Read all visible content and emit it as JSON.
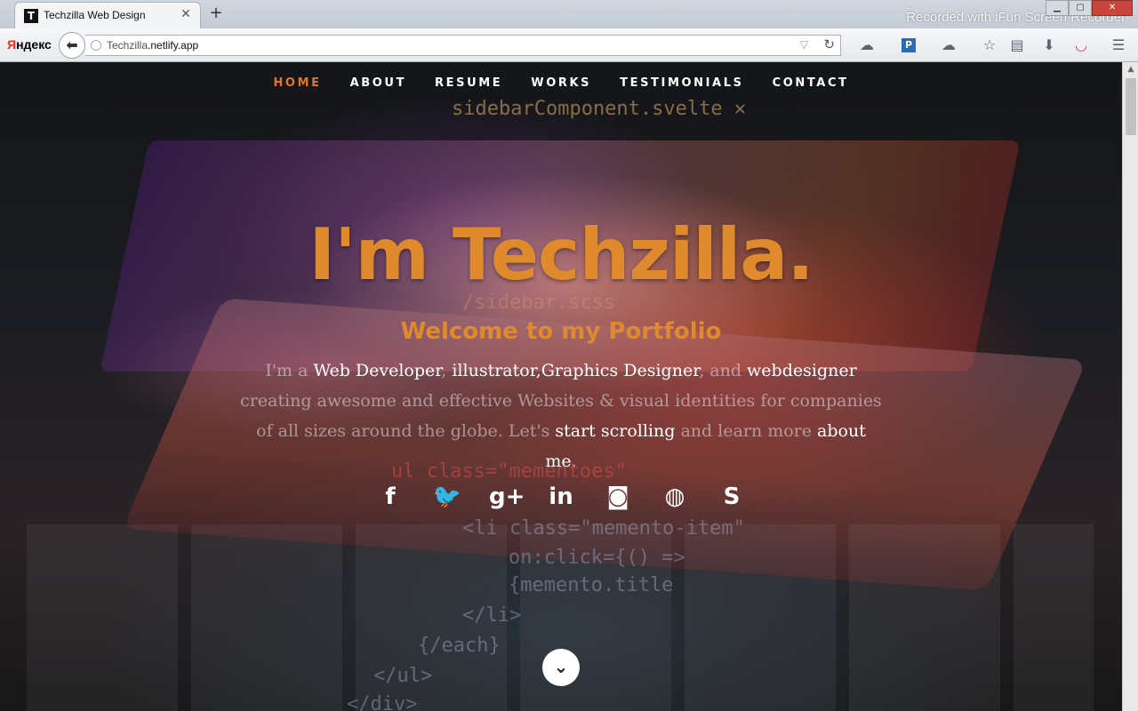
{
  "browser": {
    "tab_title": "Techzilla Web Design",
    "tab_favicon": "T",
    "tab_close": "✕",
    "new_tab": "+",
    "window_min": "▁",
    "window_max": "▢",
    "window_close": "✕",
    "watermark": "Recorded with iFun Screen Recorder",
    "yandex_first": "Я",
    "yandex_rest": "ндекс",
    "back_icon": "⬅",
    "url_host": "Techzilla",
    "url_rest": ".netlify.app",
    "url_dropdown": "▽",
    "reload_icon": "↻",
    "toolbar_icons": [
      "cloud-icon",
      "pocket-badge-icon",
      "cloud-icon",
      "bookmark-star-icon",
      "reading-list-icon",
      "download-icon",
      "pocket-icon",
      "menu-icon"
    ],
    "toolbar_glyphs": [
      "☁",
      "P",
      "☁",
      "☆",
      "▤",
      "⬇",
      "◡",
      "☰"
    ]
  },
  "site": {
    "nav": [
      {
        "label": "HOME",
        "active": true
      },
      {
        "label": "ABOUT",
        "active": false
      },
      {
        "label": "RESUME",
        "active": false
      },
      {
        "label": "WORKS",
        "active": false
      },
      {
        "label": "TESTIMONIALS",
        "active": false
      },
      {
        "label": "CONTACT",
        "active": false
      }
    ],
    "accent_color": "#e08a2e",
    "title": "I'm Techzilla.",
    "subtitle": "Welcome to my Portfolio",
    "desc": {
      "p1": "I'm a ",
      "h1": "Web Developer",
      "p2": ", ",
      "h2": "illustrator,Graphics Designer",
      "p3": ", and ",
      "h3": "webdesigner",
      "p4": " creating awesome and effective Websites & visual identities for companies of all sizes around the globe. Let's ",
      "h4": "start scrolling",
      "p5": " and learn more ",
      "h5": "about me",
      "p6": "."
    },
    "social": [
      {
        "name": "facebook-icon",
        "glyph": "f"
      },
      {
        "name": "twitter-icon",
        "glyph": "🐦"
      },
      {
        "name": "google-plus-icon",
        "glyph": "g+"
      },
      {
        "name": "linkedin-icon",
        "glyph": "in"
      },
      {
        "name": "instagram-icon",
        "glyph": "◙"
      },
      {
        "name": "dribbble-icon",
        "glyph": "◍"
      },
      {
        "name": "skype-icon",
        "glyph": "S"
      }
    ],
    "scroll_down": "⌄",
    "background_code": [
      "sidebarComponent.svelte ✕",
      "/sidebar.scss",
      "ul class=\"mementoes\"",
      "<li class=\"memento-item\"",
      "on:click={() =>",
      "{memento.title",
      "</li>",
      "{/each}",
      "</ul>",
      "</div>"
    ]
  }
}
